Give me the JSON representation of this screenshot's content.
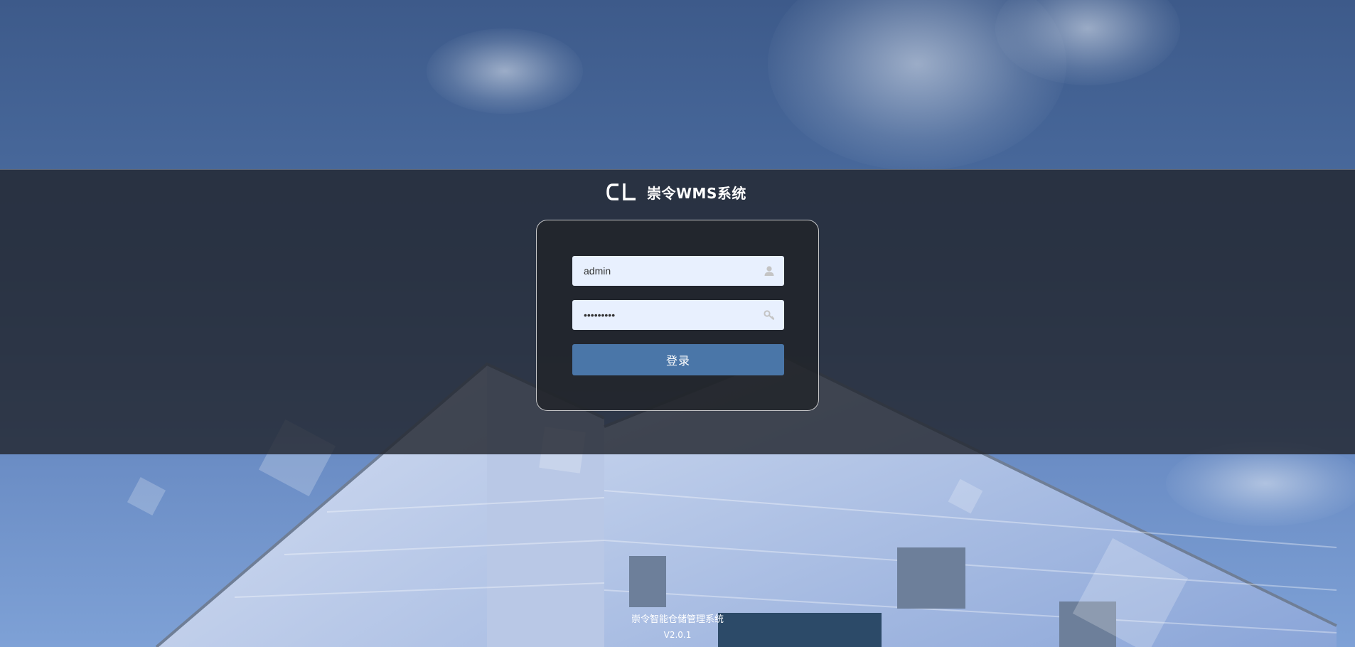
{
  "brand": {
    "logo_text": "CL",
    "title": "崇令WMS系统"
  },
  "login": {
    "username_value": "admin",
    "password_value": "password1",
    "submit_label": "登录"
  },
  "footer": {
    "system_name": "崇令智能仓储管理系统",
    "version": "V2.0.1"
  },
  "colors": {
    "button": "#4a76a8",
    "input_bg": "#e8f0fe",
    "band": "#22262e"
  },
  "icons": {
    "username": "user-icon",
    "password": "key-icon"
  }
}
